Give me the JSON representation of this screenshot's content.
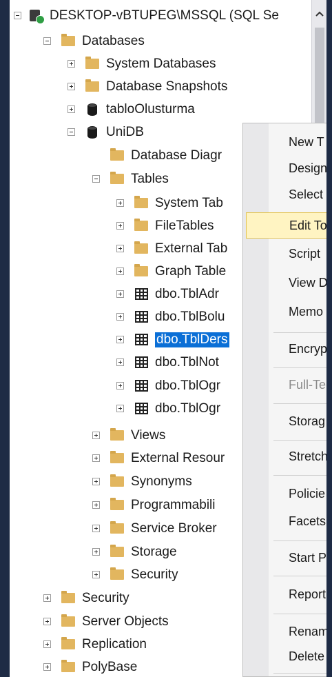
{
  "tree": {
    "server_label": "DESKTOP-vBTUPEG\\MSSQL (SQL Se",
    "databases_label": "Databases",
    "system_databases_label": "System Databases",
    "database_snapshots_label": "Database Snapshots",
    "db1_label": "tabloOlusturma",
    "db2_label": "UniDB",
    "db_diagrams_label": "Database Diagr",
    "tables_label": "Tables",
    "system_tables_label": "System Tab",
    "filetables_label": "FileTables",
    "external_tables_label": "External Tab",
    "graph_tables_label": "Graph Table",
    "table_1_label": "dbo.TblAdr",
    "table_2_label": "dbo.TblBolu",
    "table_3_label": "dbo.TblDers",
    "table_4_label": "dbo.TblNot",
    "table_5_label": "dbo.TblOgr",
    "table_6_label": "dbo.TblOgr",
    "views_label": "Views",
    "external_resources_label": "External Resour",
    "synonyms_label": "Synonyms",
    "programmability_label": "Programmabili",
    "service_broker_label": "Service Broker",
    "db_storage_label": "Storage",
    "db_security_label": "Security",
    "security_label": "Security",
    "server_objects_label": "Server Objects",
    "replication_label": "Replication",
    "polybase_label": "PolyBase"
  },
  "menu": {
    "new_table": "New T",
    "design": "Design",
    "select_top": "Select",
    "edit_top": "Edit To",
    "script_table": "Script",
    "view_dependencies": "View D",
    "memory_optimization": "Memo",
    "encrypt_columns": "Encryp",
    "full_text": "Full-Te",
    "storage": "Storag",
    "stretch": "Stretch",
    "policies": "Policie",
    "facets": "Facets",
    "start_powershell": "Start P",
    "reports": "Report",
    "rename": "Renam",
    "delete": "Delete",
    "highlighted_item": "Edit To",
    "disabled_item": "Full-Te"
  },
  "icons": {
    "server": "server-connected-icon",
    "folder": "folder-icon",
    "database": "database-icon",
    "table": "table-icon",
    "expand": "expand-plus-icon",
    "collapse": "collapse-minus-icon",
    "scroll_up": "chevron-up-icon"
  },
  "colors": {
    "window_frame": "#1e2b45",
    "selection": "#0b6fd6",
    "menu_highlight": "#fff4c2",
    "folder": "#e2b65f"
  }
}
